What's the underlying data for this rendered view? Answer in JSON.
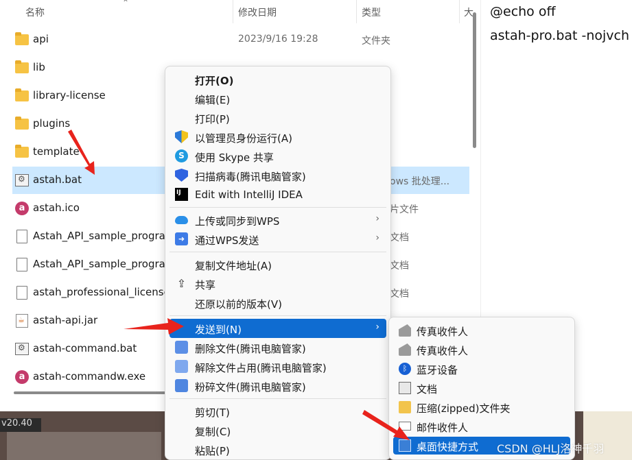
{
  "explorer": {
    "columns": {
      "name": "名称",
      "date": "修改日期",
      "type": "类型",
      "size": "大"
    },
    "rows": [
      {
        "name": "api",
        "date": "2023/9/16 19:28",
        "type": "文件夹",
        "icon": "folder-icon"
      },
      {
        "name": "lib",
        "date": "",
        "type": "",
        "icon": "folder-icon"
      },
      {
        "name": "library-license",
        "date": "",
        "type": "",
        "icon": "folder-icon"
      },
      {
        "name": "plugins",
        "date": "",
        "type": "",
        "icon": "folder-icon"
      },
      {
        "name": "template",
        "date": "",
        "type": "",
        "icon": "folder-icon"
      },
      {
        "name": "astah.bat",
        "date": "",
        "type": "ows 批处理...",
        "icon": "batch-file-icon",
        "selected": true
      },
      {
        "name": "astah.ico",
        "date": "",
        "type": "片文件",
        "icon": "astah-app-icon"
      },
      {
        "name": "Astah_API_sample_program",
        "date": "",
        "type": "文档",
        "icon": "document-icon"
      },
      {
        "name": "Astah_API_sample_program",
        "date": "",
        "type": "文档",
        "icon": "document-icon"
      },
      {
        "name": "astah_professional_license",
        "date": "",
        "type": "文档",
        "icon": "document-icon"
      },
      {
        "name": "astah-api.jar",
        "date": "",
        "type": "",
        "icon": "jar-file-icon"
      },
      {
        "name": "astah-command.bat",
        "date": "",
        "type": "",
        "icon": "batch-file-icon"
      },
      {
        "name": "astah-commandw.exe",
        "date": "",
        "type": "",
        "icon": "astah-app-icon"
      }
    ]
  },
  "preview": {
    "lines": [
      "@echo off",
      "astah-pro.bat -nojvch"
    ]
  },
  "desktop": {
    "label": "v20.40"
  },
  "context_menu": {
    "items": [
      {
        "label": "打开(O)",
        "bold": true
      },
      {
        "label": "编辑(E)"
      },
      {
        "label": "打印(P)"
      },
      {
        "label": "以管理员身份运行(A)",
        "icon": "uac-shield-icon"
      },
      {
        "label": "使用 Skype 共享",
        "icon": "skype-icon"
      },
      {
        "label": "扫描病毒(腾讯电脑管家)",
        "icon": "tencent-pc-manager-icon"
      },
      {
        "label": "Edit with IntelliJ IDEA",
        "icon": "intellij-idea-icon"
      },
      {
        "label": "上传或同步到WPS",
        "icon": "cloud-icon",
        "submenu": true
      },
      {
        "label": "通过WPS发送",
        "icon": "wps-send-icon",
        "submenu": true
      },
      {
        "label": "复制文件地址(A)"
      },
      {
        "label": "共享",
        "icon": "share-icon"
      },
      {
        "label": "还原以前的版本(V)"
      },
      {
        "label": "发送到(N)",
        "submenu": true,
        "highlighted": true
      },
      {
        "label": "删除文件(腾讯电脑管家)",
        "icon": "delete-file-icon"
      },
      {
        "label": "解除文件占用(腾讯电脑管家)",
        "icon": "unlock-file-icon"
      },
      {
        "label": "粉碎文件(腾讯电脑管家)",
        "icon": "shred-file-icon"
      },
      {
        "label": "剪切(T)"
      },
      {
        "label": "复制(C)"
      },
      {
        "label": "粘贴(P)"
      }
    ],
    "chevron": "›"
  },
  "send_to_menu": {
    "items": [
      {
        "label": "传真收件人",
        "icon": "fax-icon"
      },
      {
        "label": "传真收件人",
        "icon": "fax-icon"
      },
      {
        "label": "蓝牙设备",
        "icon": "bluetooth-icon"
      },
      {
        "label": "文档",
        "icon": "documents-icon"
      },
      {
        "label": "压缩(zipped)文件夹",
        "icon": "zip-folder-icon"
      },
      {
        "label": "邮件收件人",
        "icon": "mail-icon"
      },
      {
        "label": "桌面快捷方式",
        "icon": "desktop-shortcut-icon",
        "highlighted": true
      }
    ]
  },
  "watermark": "CSDN @HLJ洛神千羽",
  "colors": {
    "highlight": "#0f6cd1",
    "selection": "#cce8ff",
    "arrow": "#e8231c"
  }
}
